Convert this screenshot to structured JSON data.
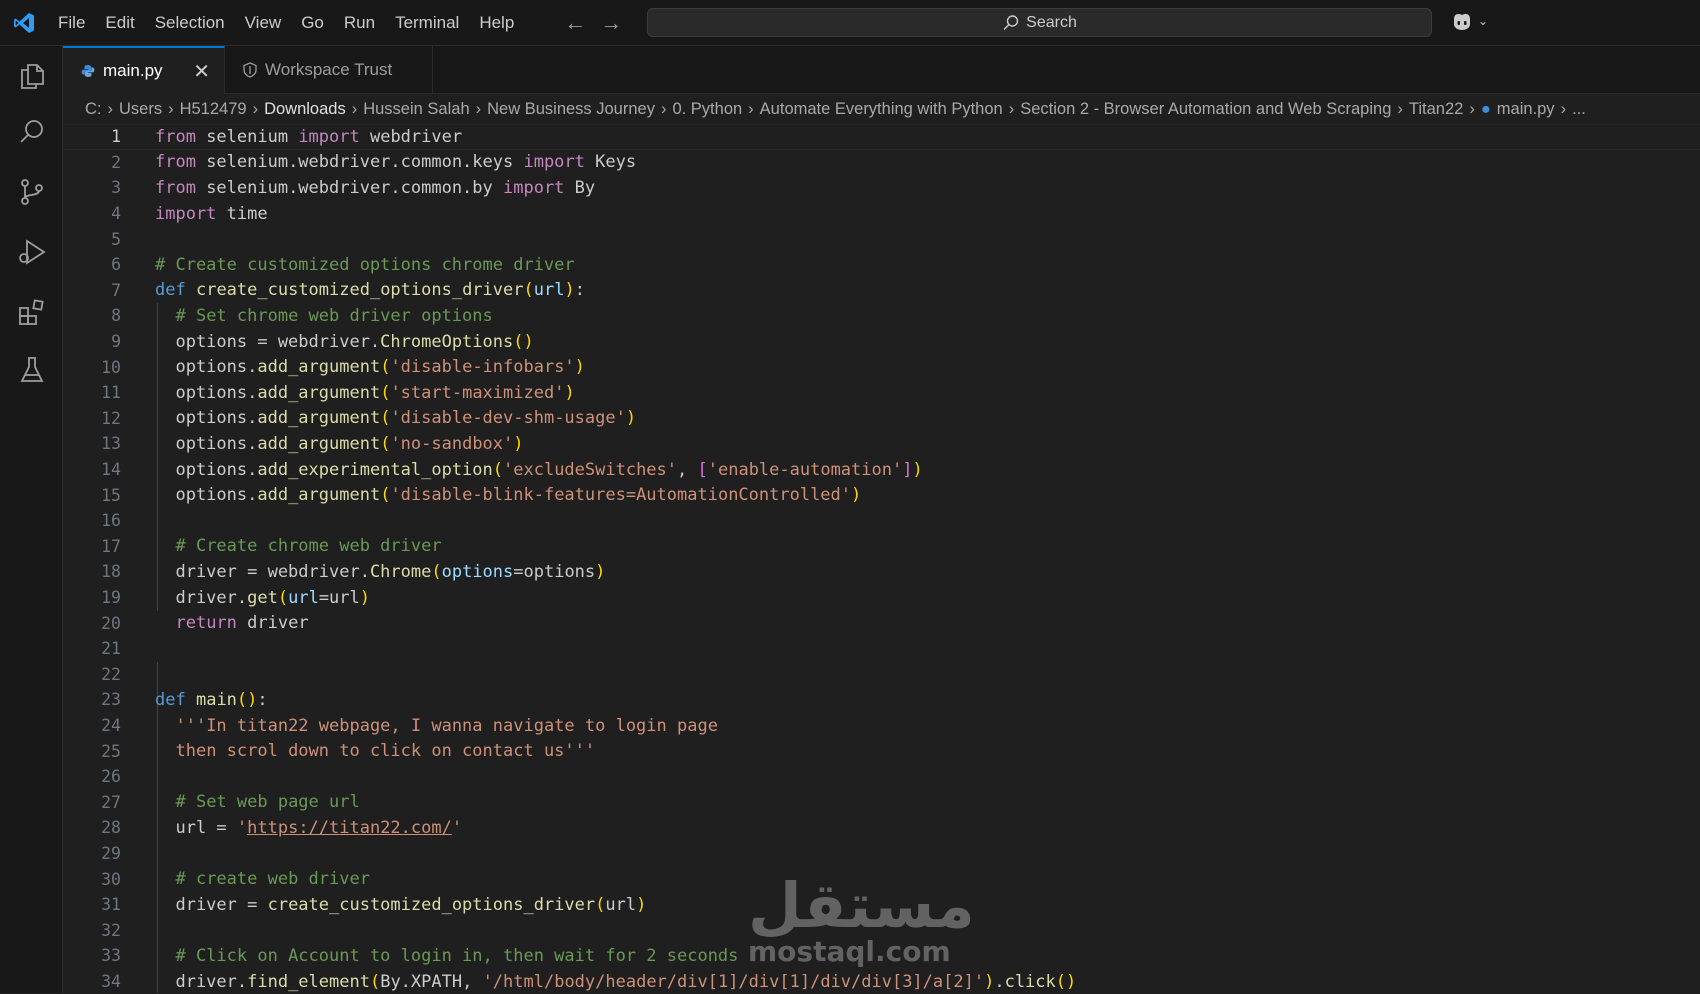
{
  "menu": [
    "File",
    "Edit",
    "Selection",
    "View",
    "Go",
    "Run",
    "Terminal",
    "Help"
  ],
  "search": {
    "label": "Search"
  },
  "tabs": [
    {
      "label": "main.py"
    },
    {
      "label": "Workspace Trust"
    }
  ],
  "breadcrumb": [
    "C:",
    "Users",
    "H512479",
    "Downloads",
    "Hussein Salah",
    "New Business Journey",
    "0. Python",
    "Automate Everything with Python",
    "Section 2 - Browser Automation and Web Scraping",
    "Titan22",
    "main.py",
    "..."
  ],
  "editor": {
    "current_line": 1,
    "line_numbers": [
      "1",
      "2",
      "3",
      "4",
      "5",
      "6",
      "7",
      "8",
      "9",
      "10",
      "11",
      "12",
      "13",
      "14",
      "15",
      "16",
      "17",
      "18",
      "19",
      "20",
      "21",
      "22",
      "23",
      "24",
      "25",
      "26",
      "27",
      "28",
      "29",
      "30",
      "31",
      "32",
      "33",
      "34"
    ]
  },
  "watermark": {
    "arabic": "مستقل",
    "latin": "mostaql.com"
  },
  "colors": {
    "accent": "#0078d4",
    "keyword": "#c586c0",
    "def_keyword": "#569cd6",
    "function": "#dcdcaa",
    "string": "#ce9178",
    "comment": "#6a9955",
    "param": "#9cdcfe"
  },
  "icons": [
    "vscode-logo",
    "files-icon",
    "search-icon",
    "source-control-icon",
    "run-debug-icon",
    "extensions-icon",
    "testing-icon",
    "copilot-icon",
    "python-file-icon",
    "shield-icon",
    "close-icon"
  ]
}
